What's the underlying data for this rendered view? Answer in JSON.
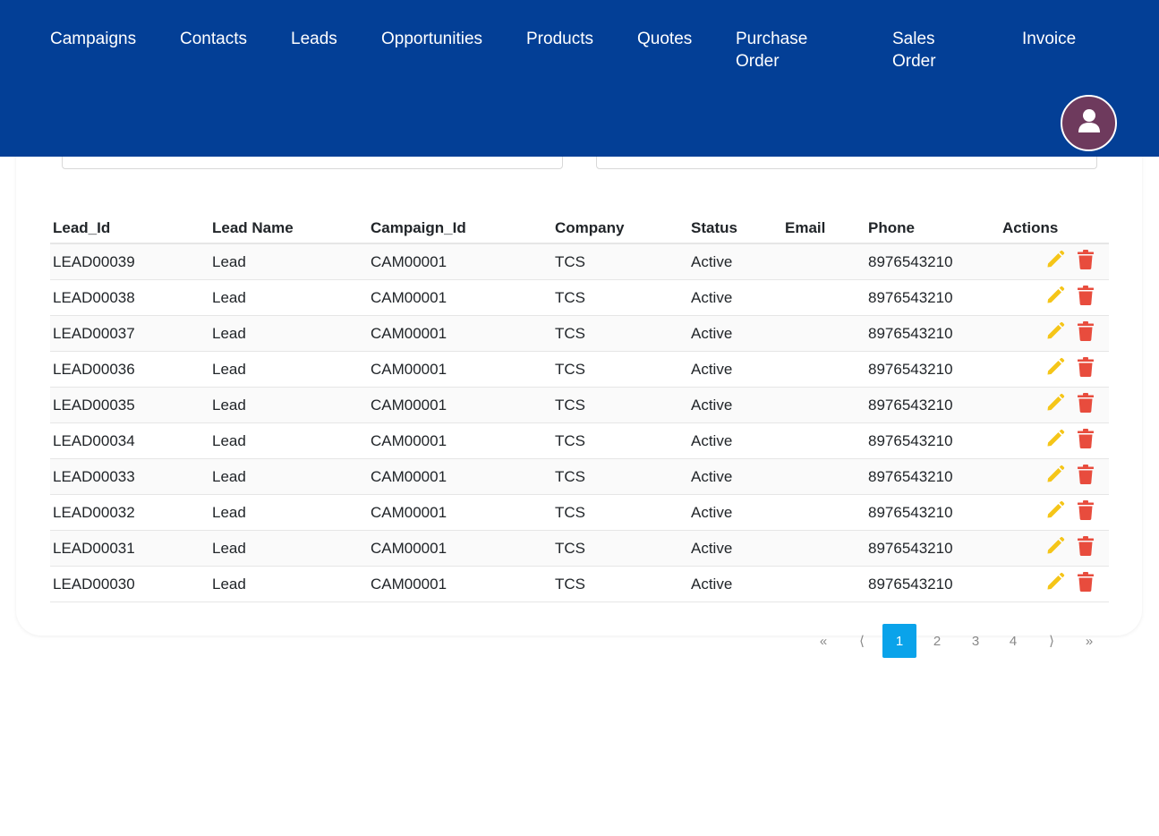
{
  "nav": {
    "items": [
      {
        "label": "Campaigns"
      },
      {
        "label": "Contacts"
      },
      {
        "label": "Leads"
      },
      {
        "label": "Opportunities"
      },
      {
        "label": "Products"
      },
      {
        "label": "Quotes"
      },
      {
        "label": "Purchase Order"
      },
      {
        "label": "Sales Order"
      },
      {
        "label": "Invoice"
      }
    ]
  },
  "colors": {
    "header_bg": "#033f96",
    "avatar_bg": "#6e3a5d",
    "edit_icon": "#f5c518",
    "delete_icon": "#e84c3d",
    "active_page": "#0aa3ea"
  },
  "table": {
    "headers": {
      "lead_id": "Lead_Id",
      "lead_name": "Lead Name",
      "campaign_id": "Campaign_Id",
      "company": "Company",
      "status": "Status",
      "email": "Email",
      "phone": "Phone",
      "actions": "Actions"
    },
    "rows": [
      {
        "lead_id": "LEAD00039",
        "lead_name": "Lead",
        "campaign_id": "CAM00001",
        "company": "TCS",
        "status": "Active",
        "email": "",
        "phone": "8976543210"
      },
      {
        "lead_id": "LEAD00038",
        "lead_name": "Lead",
        "campaign_id": "CAM00001",
        "company": "TCS",
        "status": "Active",
        "email": "",
        "phone": "8976543210"
      },
      {
        "lead_id": "LEAD00037",
        "lead_name": "Lead",
        "campaign_id": "CAM00001",
        "company": "TCS",
        "status": "Active",
        "email": "",
        "phone": "8976543210"
      },
      {
        "lead_id": "LEAD00036",
        "lead_name": "Lead",
        "campaign_id": "CAM00001",
        "company": "TCS",
        "status": "Active",
        "email": "",
        "phone": "8976543210"
      },
      {
        "lead_id": "LEAD00035",
        "lead_name": "Lead",
        "campaign_id": "CAM00001",
        "company": "TCS",
        "status": "Active",
        "email": "",
        "phone": "8976543210"
      },
      {
        "lead_id": "LEAD00034",
        "lead_name": "Lead",
        "campaign_id": "CAM00001",
        "company": "TCS",
        "status": "Active",
        "email": "",
        "phone": "8976543210"
      },
      {
        "lead_id": "LEAD00033",
        "lead_name": "Lead",
        "campaign_id": "CAM00001",
        "company": "TCS",
        "status": "Active",
        "email": "",
        "phone": "8976543210"
      },
      {
        "lead_id": "LEAD00032",
        "lead_name": "Lead",
        "campaign_id": "CAM00001",
        "company": "TCS",
        "status": "Active",
        "email": "",
        "phone": "8976543210"
      },
      {
        "lead_id": "LEAD00031",
        "lead_name": "Lead",
        "campaign_id": "CAM00001",
        "company": "TCS",
        "status": "Active",
        "email": "",
        "phone": "8976543210"
      },
      {
        "lead_id": "LEAD00030",
        "lead_name": "Lead",
        "campaign_id": "CAM00001",
        "company": "TCS",
        "status": "Active",
        "email": "",
        "phone": "8976543210"
      }
    ],
    "row_icons": {
      "edit": "pencil-icon",
      "delete": "trash-icon"
    }
  },
  "pagination": {
    "first": "«",
    "prev": "⟨",
    "pages": [
      "1",
      "2",
      "3",
      "4"
    ],
    "active": "1",
    "next": "⟩",
    "last": "»"
  },
  "profile": {
    "icon": "user-icon"
  }
}
